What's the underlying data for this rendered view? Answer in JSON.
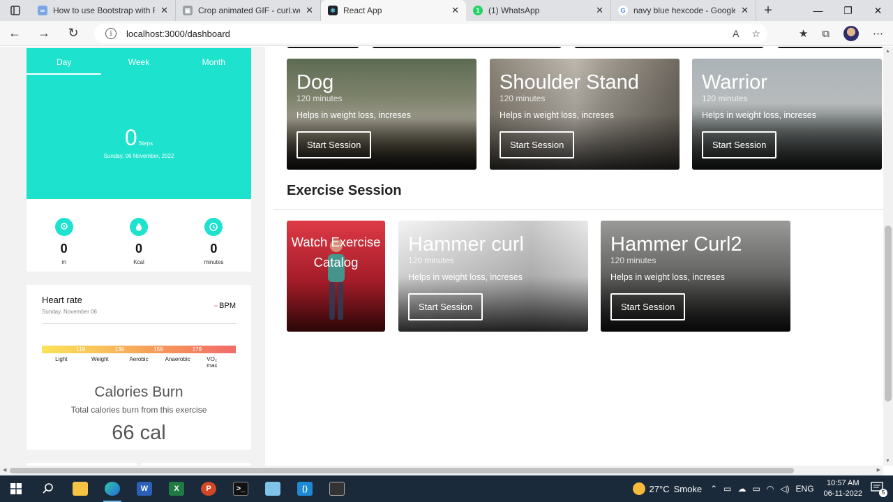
{
  "browser": {
    "tabs": [
      {
        "title": "How to use Bootstrap with Fl",
        "favicon": "cloud-icon",
        "active": false
      },
      {
        "title": "Crop animated GIF - curl.web",
        "favicon": "gif-icon",
        "active": false
      },
      {
        "title": "React App",
        "favicon": "react-icon",
        "active": true
      },
      {
        "title": "(1) WhatsApp",
        "favicon": "whatsapp-icon",
        "active": false
      },
      {
        "title": "navy blue hexcode - Google",
        "favicon": "google-icon",
        "active": false
      }
    ],
    "url": "localhost:3000/dashboard"
  },
  "sidebar": {
    "period_tabs": [
      "Day",
      "Week",
      "Month"
    ],
    "selected_period": "Day",
    "steps": {
      "value": "0",
      "unit": "Steps",
      "date": "Sunday, 06 November, 2022"
    },
    "stats": [
      {
        "icon": "location-pin-icon",
        "value": "0",
        "unit": "m"
      },
      {
        "icon": "flame-icon",
        "value": "0",
        "unit": "Kcal"
      },
      {
        "icon": "clock-icon",
        "value": "0",
        "unit": "minutes"
      }
    ],
    "heart_rate": {
      "title": "Heart rate",
      "date": "Sunday, November 06",
      "bpm_label": "BPM",
      "bpm_value": "--",
      "ticks": [
        "119",
        "139",
        "159",
        "179"
      ],
      "zones": [
        "Light",
        "Weight",
        "Aerobic",
        "Anaerobic",
        "VO₂ max"
      ]
    },
    "calories": {
      "title": "Calories Burn",
      "subtitle": "Total calories burn from this exercise",
      "value": "66 cal"
    }
  },
  "yoga_sessions": [
    {
      "title": "Dog",
      "duration": "120 minutes",
      "description": "Helps in weight loss, increses",
      "button": "Start Session"
    },
    {
      "title": "Shoulder Stand",
      "duration": "120 minutes",
      "description": "Helps in weight loss, increses",
      "button": "Start Session"
    },
    {
      "title": "Warrior",
      "duration": "120 minutes",
      "description": "Helps in weight loss, increses",
      "button": "Start Session"
    }
  ],
  "exercise": {
    "section_title": "Exercise Session",
    "catalog_label": "Watch Exercise Catalog",
    "sessions": [
      {
        "title": "Hammer curl",
        "duration": "120 minutes",
        "description": "Helps in weight loss, increses",
        "button": "Start Session"
      },
      {
        "title": "Hammer Curl2",
        "duration": "120 minutes",
        "description": "Helps in weight loss, increses",
        "button": "Start Session"
      }
    ]
  },
  "taskbar": {
    "weather": {
      "temp": "27°C",
      "condition": "Smoke"
    },
    "language": "ENG",
    "time": "10:57 AM",
    "date": "06-11-2022",
    "notifications": "5"
  },
  "colors": {
    "accent": "#1de2cd",
    "catalog_red": "#dd3a46"
  }
}
